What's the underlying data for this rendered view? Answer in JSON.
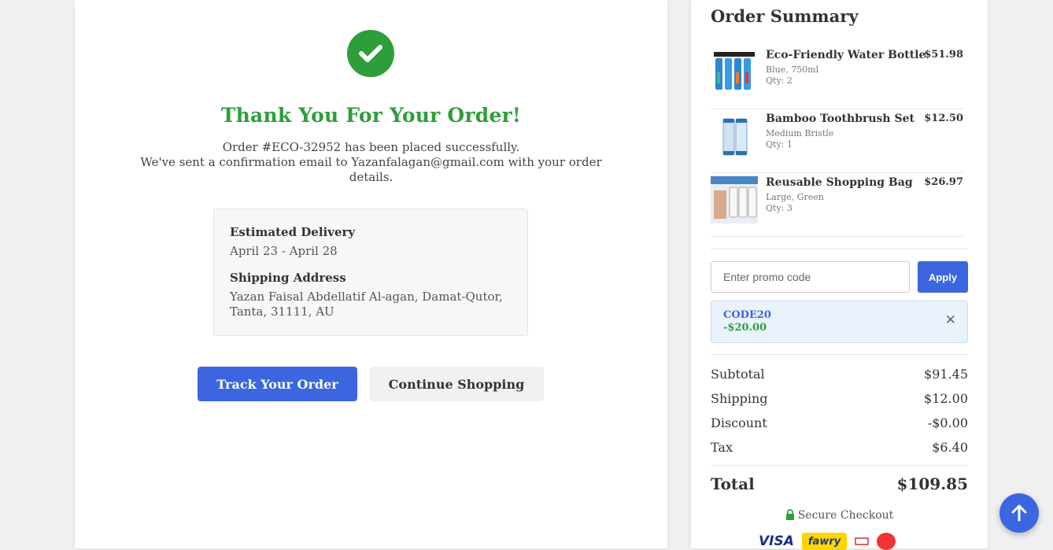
{
  "confirmation": {
    "title": "Thank You For Your Order!",
    "order_line": "Order #ECO-32952 has been placed successfully.",
    "email_line": "We've sent a confirmation email to Yazanfalagan@gmail.com with your order details."
  },
  "delivery": {
    "estimated_label": "Estimated Delivery",
    "estimated_value": "April 23 - April 28",
    "address_label": "Shipping Address",
    "address_value": "Yazan Faisal Abdellatif Al-agan, Damat-Qutor, Tanta, 31111, AU"
  },
  "actions": {
    "track_label": "Track Your Order",
    "continue_label": "Continue Shopping"
  },
  "summary": {
    "title": "Order Summary",
    "items": [
      {
        "name": "Eco-Friendly Water Bottle",
        "variant": "Blue, 750ml",
        "qty": "Qty: 2",
        "price": "$51.98",
        "icon": "water-filter-image"
      },
      {
        "name": "Bamboo Toothbrush Set",
        "variant": "Medium Bristle",
        "qty": "Qty: 1",
        "price": "$12.50",
        "icon": "filter-cartridge-image"
      },
      {
        "name": "Reusable Shopping Bag",
        "variant": "Large, Green",
        "qty": "Qty: 3",
        "price": "$26.97",
        "icon": "filter-system-image"
      }
    ],
    "promo": {
      "placeholder": "Enter promo code",
      "apply_label": "Apply",
      "applied_code": "CODE20",
      "applied_amount": "-$20.00"
    },
    "totals": {
      "subtotal_label": "Subtotal",
      "subtotal_value": "$91.45",
      "shipping_label": "Shipping",
      "shipping_value": "$12.00",
      "discount_label": "Discount",
      "discount_value": "-$0.00",
      "tax_label": "Tax",
      "tax_value": "$6.40",
      "total_label": "Total",
      "total_value": "$109.85"
    },
    "secure_label": "Secure Checkout",
    "payment_logos": {
      "visa": "VISA",
      "fawry": "fawry"
    }
  },
  "colors": {
    "success": "#2e9e3a",
    "primary": "#3b66e0"
  }
}
